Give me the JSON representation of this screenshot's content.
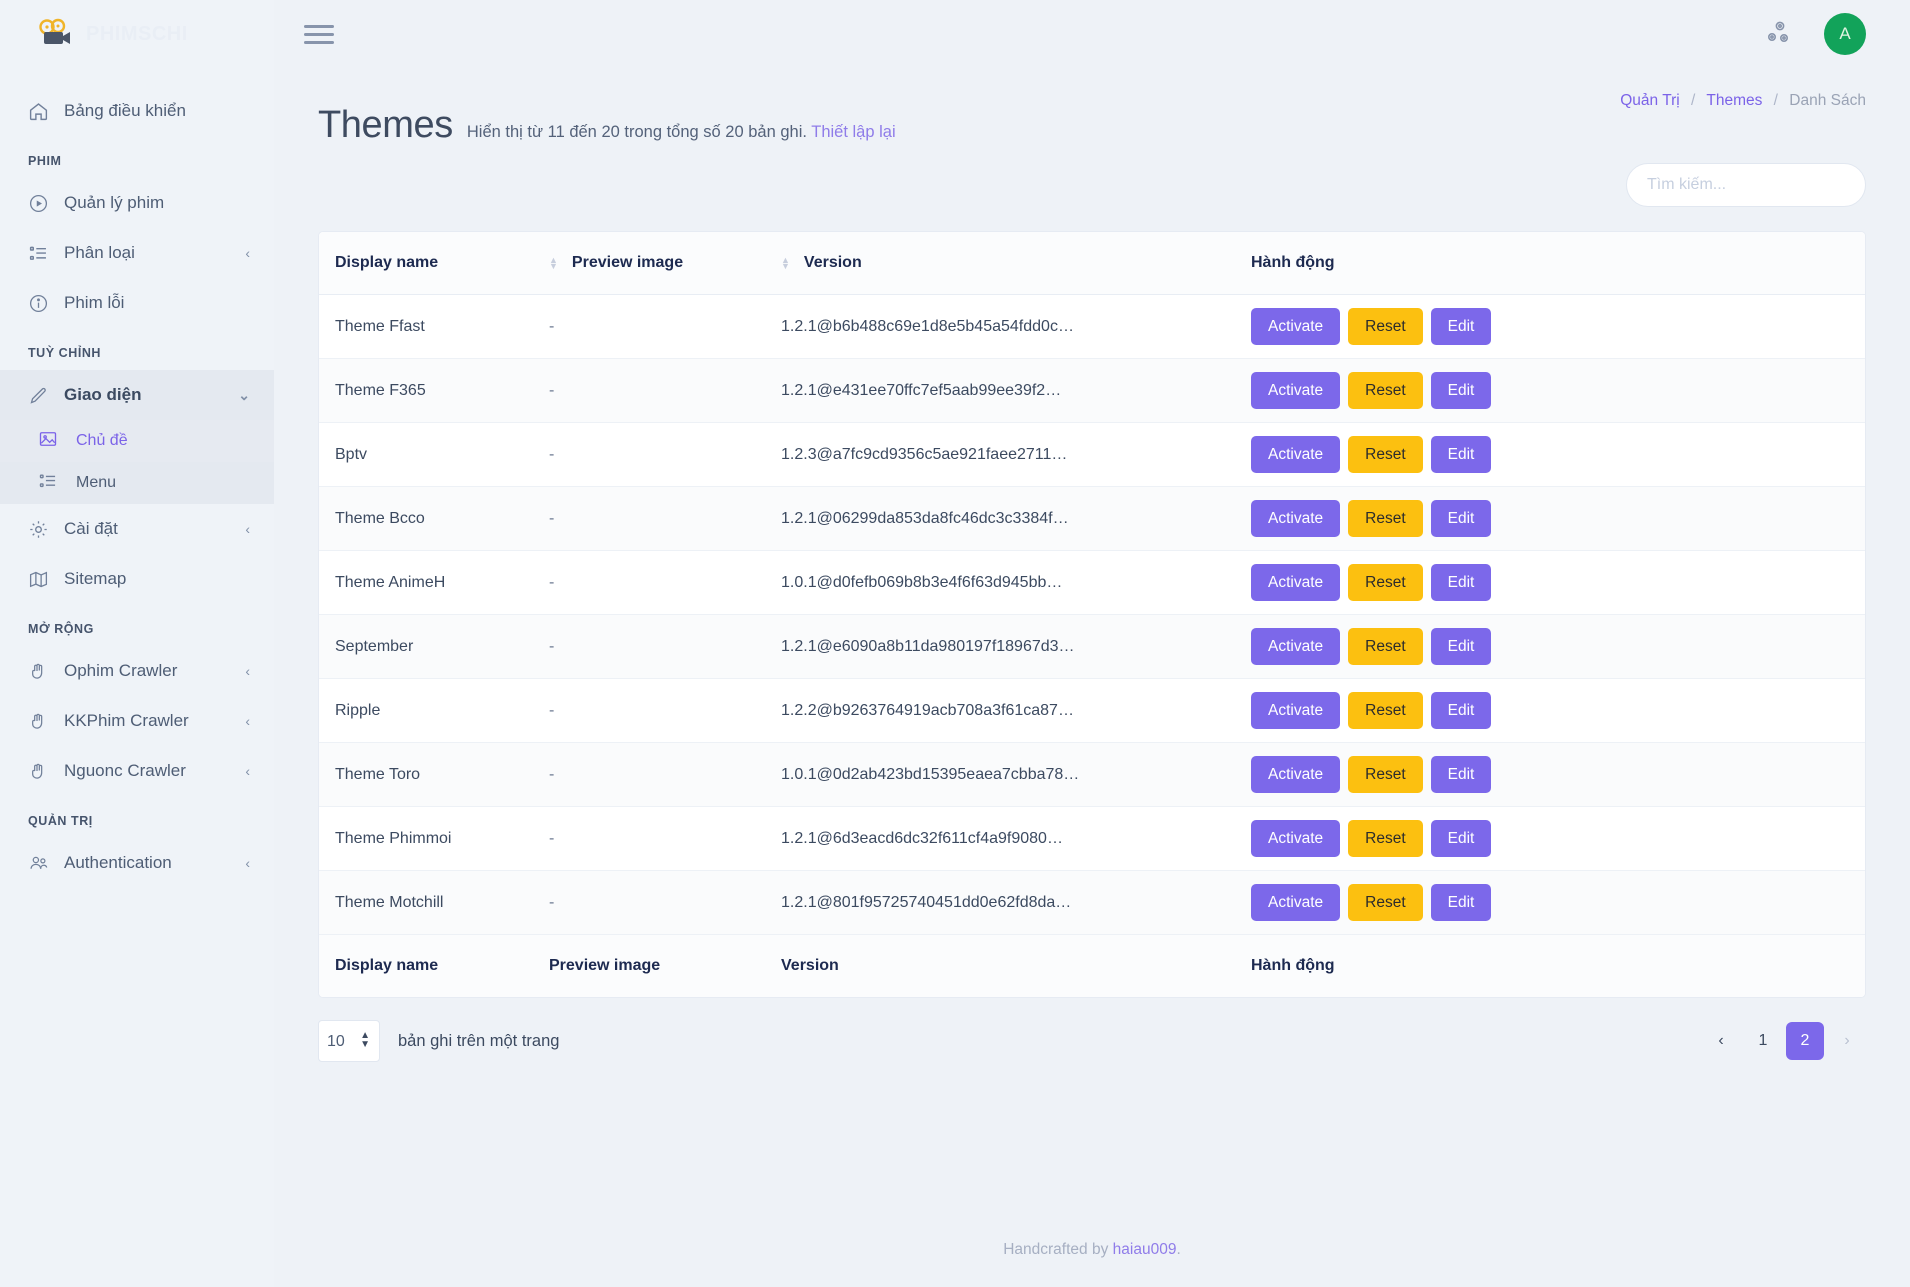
{
  "brand": {
    "name": "PHIMSCHI",
    "logo_icon": "film-camera-icon"
  },
  "topbar": {
    "menu_toggle_icon": "hamburger-icon",
    "settings_icon": "gears-icon",
    "avatar_initial": "A"
  },
  "breadcrumb": {
    "items": [
      {
        "label": "Quản Trị",
        "current": false
      },
      {
        "label": "Themes",
        "current": false
      },
      {
        "label": "Danh Sách",
        "current": true
      }
    ],
    "separator": "/"
  },
  "page": {
    "title": "Themes",
    "subtitle": "Hiển thị từ 11 đến 20 trong tổng số 20 bản ghi.",
    "reset_link": "Thiết lập lại"
  },
  "search": {
    "placeholder": "Tìm kiếm...",
    "value": ""
  },
  "sidebar": {
    "dashboard": {
      "label": "Bảng điều khiển",
      "icon": "home-icon"
    },
    "sections": [
      {
        "title": "PHIM",
        "items": [
          {
            "label": "Quản lý phim",
            "icon": "play-circle-icon",
            "chevron": ""
          },
          {
            "label": "Phân loại",
            "icon": "list-icon",
            "chevron": "‹"
          },
          {
            "label": "Phim lỗi",
            "icon": "info-circle-icon",
            "chevron": ""
          }
        ]
      },
      {
        "title": "TUỲ CHỈNH",
        "items": [
          {
            "label": "Giao diện",
            "icon": "pencil-icon",
            "chevron": "⌄",
            "open": true,
            "children": [
              {
                "label": "Chủ đề",
                "icon": "image-icon",
                "active": true
              },
              {
                "label": "Menu",
                "icon": "list-icon",
                "active": false
              }
            ]
          },
          {
            "label": "Cài đặt",
            "icon": "gear-icon",
            "chevron": "‹"
          },
          {
            "label": "Sitemap",
            "icon": "map-icon",
            "chevron": ""
          }
        ]
      },
      {
        "title": "MỞ RỘNG",
        "items": [
          {
            "label": "Ophim Crawler",
            "icon": "hand-icon",
            "chevron": "‹"
          },
          {
            "label": "KKPhim Crawler",
            "icon": "hand-icon",
            "chevron": "‹"
          },
          {
            "label": "Nguonc Crawler",
            "icon": "hand-icon",
            "chevron": "‹"
          }
        ]
      },
      {
        "title": "QUẢN TRỊ",
        "items": [
          {
            "label": "Authentication",
            "icon": "users-icon",
            "chevron": "‹"
          }
        ]
      }
    ]
  },
  "table": {
    "columns": [
      {
        "label": "Display name",
        "sortable": false
      },
      {
        "label": "Preview image",
        "sortable": true
      },
      {
        "label": "Version",
        "sortable": true
      },
      {
        "label": "Hành động",
        "sortable": false
      }
    ],
    "actions": {
      "activate": "Activate",
      "reset": "Reset",
      "edit": "Edit"
    },
    "rows": [
      {
        "name": "Theme Ffast",
        "preview": "-",
        "version": "1.2.1@b6b488c69e1d8e5b45a54fdd0c…"
      },
      {
        "name": "Theme F365",
        "preview": "-",
        "version": "1.2.1@e431ee70ffc7ef5aab99ee39f2…"
      },
      {
        "name": "Bptv",
        "preview": "-",
        "version": "1.2.3@a7fc9cd9356c5ae921faee2711…"
      },
      {
        "name": "Theme Bcco",
        "preview": "-",
        "version": "1.2.1@06299da853da8fc46dc3c3384f…"
      },
      {
        "name": "Theme AnimeH",
        "preview": "-",
        "version": "1.0.1@d0fefb069b8b3e4f6f63d945bb…"
      },
      {
        "name": "September",
        "preview": "-",
        "version": "1.2.1@e6090a8b11da980197f18967d3…"
      },
      {
        "name": "Ripple",
        "preview": "-",
        "version": "1.2.2@b9263764919acb708a3f61ca87…"
      },
      {
        "name": "Theme Toro",
        "preview": "-",
        "version": "1.0.1@0d2ab423bd15395eaea7cbba78…"
      },
      {
        "name": "Theme Phimmoi",
        "preview": "-",
        "version": "1.2.1@6d3eacd6dc32f611cf4a9f9080…"
      },
      {
        "name": "Theme Motchill",
        "preview": "-",
        "version": "1.2.1@801f95725740451dd0e62fd8da…"
      }
    ]
  },
  "pagination": {
    "per_page_value": "10",
    "per_page_label": "bản ghi trên một trang",
    "prev": "‹",
    "next": "›",
    "pages": [
      {
        "label": "1",
        "active": false
      },
      {
        "label": "2",
        "active": true
      }
    ]
  },
  "footer": {
    "prefix": "Handcrafted by ",
    "author": "haiau009",
    "suffix": "."
  },
  "colors": {
    "accent_purple": "#7c68ea",
    "accent_yellow": "#fcc010",
    "avatar_green": "#12a35a",
    "page_bg": "#eef2f7",
    "sidebar_bg": "#eff3f8"
  }
}
